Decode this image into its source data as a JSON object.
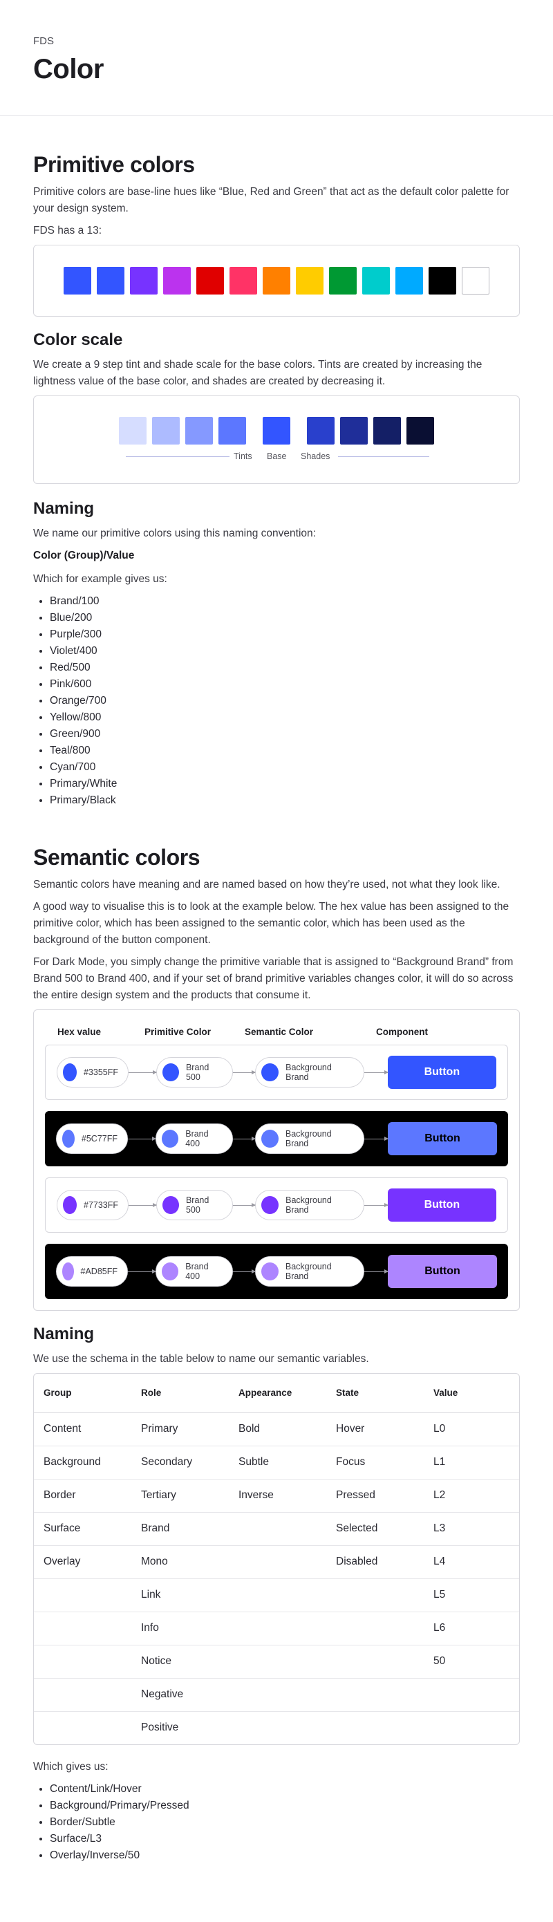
{
  "header": {
    "eyebrow": "FDS",
    "title": "Color"
  },
  "primitive": {
    "title": "Primitive colors",
    "intro": "Primitive colors are base-line hues like “Blue, Red and Green” that act as the default color palette for your design system.",
    "count_text": "FDS has a 13:",
    "swatches": [
      "#3355FF",
      "#3355FF",
      "#7733FF",
      "#BB33EE",
      "#E00000",
      "#FF3366",
      "#FF8000",
      "#FFCC00",
      "#009933",
      "#00CCCC",
      "#00AAFF",
      "#000000",
      "#FFFFFF"
    ]
  },
  "scale": {
    "title": "Color scale",
    "text": "We create a 9 step tint and shade scale for the base colors. Tints are created by increasing the lightness value of the base color, and shades are created by decreasing it.",
    "tints": [
      "#D6DDFF",
      "#ADBBFF",
      "#8599FF",
      "#5C77FF"
    ],
    "base": "#3355FF",
    "shades": [
      "#2940CC",
      "#1F2E99",
      "#141F66",
      "#0A0F33"
    ],
    "label_tints": "Tints",
    "label_base": "Base",
    "label_shades": "Shades"
  },
  "naming_primitive": {
    "title": "Naming",
    "text": "We name our primitive colors using this naming convention:",
    "convention": "Color (Group)/Value",
    "example_intro": "Which for example gives us:",
    "examples": [
      "Brand/100",
      "Blue/200",
      "Purple/300",
      "Violet/400",
      "Red/500",
      "Pink/600",
      "Orange/700",
      "Yellow/800",
      "Green/900",
      "Teal/800",
      "Cyan/700",
      "Primary/White",
      "Primary/Black"
    ]
  },
  "semantic": {
    "title": "Semantic colors",
    "p1": "Semantic colors have meaning and are named based on how they’re used, not what they look like.",
    "p2": "A good way to visualise this is to look at the example below. The hex value has been assigned to the primitive color, which has been assigned to the semantic color, which has been used as the background of the button component.",
    "p3": "For Dark Mode, you simply change the primitive variable that is assigned to “Background Brand” from Brand 500 to Brand 400, and if your set of brand primitive variables changes color, it will do so across the entire design system and the products that consume it.",
    "headers": {
      "hex": "Hex value",
      "primitive": "Primitive Color",
      "semantic": "Semantic Color",
      "component": "Component"
    },
    "rows": [
      {
        "theme": "light",
        "color": "#3355FF",
        "hex": "#3355FF",
        "primitive": "Brand 500",
        "semantic": "Background Brand",
        "button": "Button",
        "button_text_color": "#FFFFFF"
      },
      {
        "theme": "dark",
        "color": "#5C77FF",
        "hex": "#5C77FF",
        "primitive": "Brand 400",
        "semantic": "Background Brand",
        "button": "Button",
        "button_text_color": "#000000"
      },
      {
        "theme": "light",
        "color": "#7733FF",
        "hex": "#7733FF",
        "primitive": "Brand 500",
        "semantic": "Background Brand",
        "button": "Button",
        "button_text_color": "#FFFFFF"
      },
      {
        "theme": "dark",
        "color": "#AD85FF",
        "hex": "#AD85FF",
        "primitive": "Brand 400",
        "semantic": "Background Brand",
        "button": "Button",
        "button_text_color": "#000000"
      }
    ]
  },
  "naming_semantic": {
    "title": "Naming",
    "text": "We use the schema in the table below to name our semantic variables.",
    "columns": [
      "Group",
      "Role",
      "Appearance",
      "State",
      "Value"
    ],
    "rows": [
      [
        "Content",
        "Primary",
        "Bold",
        "Hover",
        "L0"
      ],
      [
        "Background",
        "Secondary",
        "Subtle",
        "Focus",
        "L1"
      ],
      [
        "Border",
        "Tertiary",
        "Inverse",
        "Pressed",
        "L2"
      ],
      [
        "Surface",
        "Brand",
        "",
        "Selected",
        "L3"
      ],
      [
        "Overlay",
        "Mono",
        "",
        "Disabled",
        "L4"
      ],
      [
        "",
        "Link",
        "",
        "",
        "L5"
      ],
      [
        "",
        "Info",
        "",
        "",
        "L6"
      ],
      [
        "",
        "Notice",
        "",
        "",
        "50"
      ],
      [
        "",
        "Negative",
        "",
        "",
        ""
      ],
      [
        "",
        "Positive",
        "",
        "",
        ""
      ]
    ],
    "result_intro": "Which gives us:",
    "results": [
      "Content/Link/Hover",
      "Background/Primary/Pressed",
      "Border/Subtle",
      "Surface/L3",
      "Overlay/Inverse/50"
    ]
  }
}
